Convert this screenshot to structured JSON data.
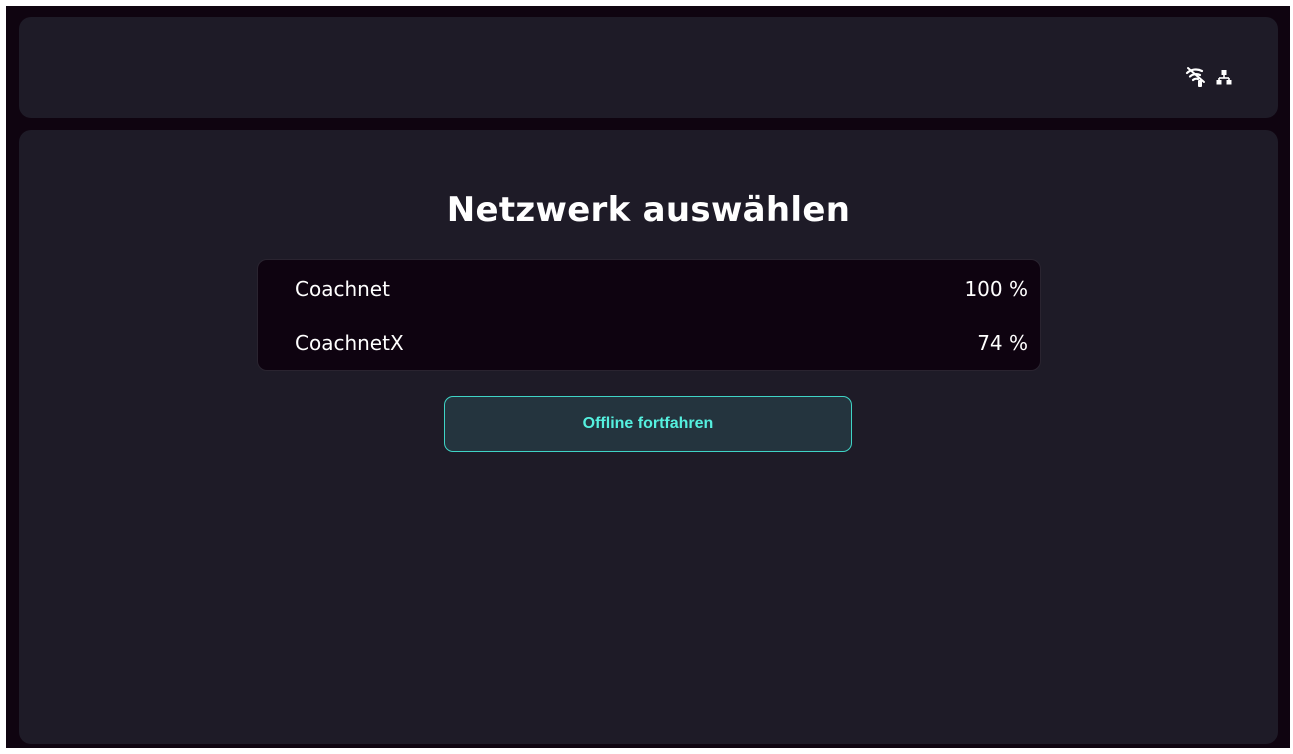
{
  "status_bar": {
    "icons": [
      "wifi-off-icon",
      "network-ethernet-icon"
    ]
  },
  "main": {
    "title": "Netzwerk auswählen",
    "networks": [
      {
        "name": "Coachnet",
        "signal": "100 %"
      },
      {
        "name": "CoachnetX",
        "signal": "74 %"
      }
    ],
    "offline_button_label": "Offline fortfahren"
  },
  "colors": {
    "background": "#0f0410",
    "panel": "#1e1b27",
    "list_background": "#0e0310",
    "button_background": "#24343e",
    "accent": "#55f0df"
  }
}
